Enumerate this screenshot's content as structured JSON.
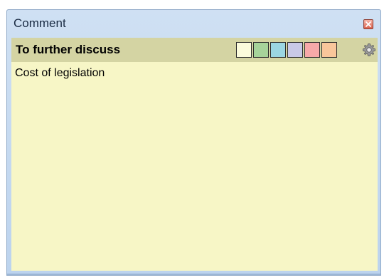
{
  "window": {
    "title": "Comment"
  },
  "header": {
    "label": "To further discuss"
  },
  "swatches": [
    {
      "color": "#fbfbdc",
      "name": "color-swatch-cream"
    },
    {
      "color": "#a6d39a",
      "name": "color-swatch-green"
    },
    {
      "color": "#9bd6e2",
      "name": "color-swatch-cyan"
    },
    {
      "color": "#c9c9e6",
      "name": "color-swatch-lavender"
    },
    {
      "color": "#f7a9a9",
      "name": "color-swatch-pink"
    },
    {
      "color": "#f9c69b",
      "name": "color-swatch-orange"
    }
  ],
  "comment": {
    "text": "Cost of legislation"
  },
  "colors": {
    "header_bg": "#d4d4a3",
    "body_bg": "#f7f6c6",
    "titlebar_bg": "#c6dbf1"
  },
  "icons": {
    "close": "close-icon",
    "settings": "gear-icon"
  }
}
